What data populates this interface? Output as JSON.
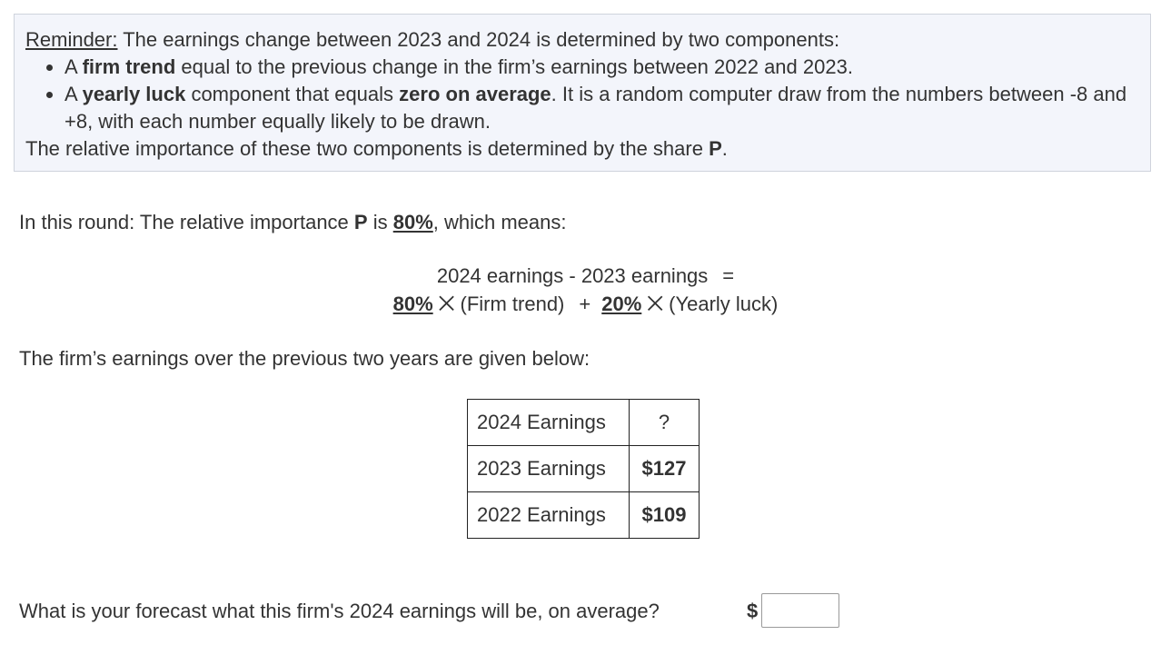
{
  "reminder": {
    "label": "Reminder:",
    "intro": " The earnings change between 2023 and 2024 is determined by two components:",
    "bullet1": {
      "pre": "A ",
      "bold": "firm trend",
      "post": " equal to the previous change in the firm’s earnings between 2022 and 2023."
    },
    "bullet2": {
      "pre": "A ",
      "bold1": "yearly luck",
      "mid": " component that equals ",
      "bold2": "zero on average",
      "post": ". It is a random computer draw from the numbers between -8 and +8, with each number equally likely to be drawn."
    },
    "closing_pre": "The relative importance of these two components is determined by the share ",
    "closing_bold": "P",
    "closing_post": "."
  },
  "round": {
    "pre": "In this round: The relative importance ",
    "p_label": "P",
    "mid": " is ",
    "p_value": "80%",
    "post": ", which means:"
  },
  "equation": {
    "lhs": "2024 earnings - 2023 earnings",
    "equals": "=",
    "weight1": "80%",
    "term1": " ⨉ (Firm trend)",
    "plus": "+",
    "weight2": "20%",
    "term2": " ⨉ (Yearly luck)"
  },
  "previous_text": "The firm’s earnings over the previous two years are given below:",
  "earnings_table": [
    {
      "label": "2024 Earnings",
      "value": "?"
    },
    {
      "label": "2023 Earnings",
      "value": "$127"
    },
    {
      "label": "2022 Earnings",
      "value": "$109"
    }
  ],
  "forecast": {
    "question": "What is your forecast what this firm's 2024 earnings will be, on average?",
    "currency": "$",
    "input_value": ""
  }
}
